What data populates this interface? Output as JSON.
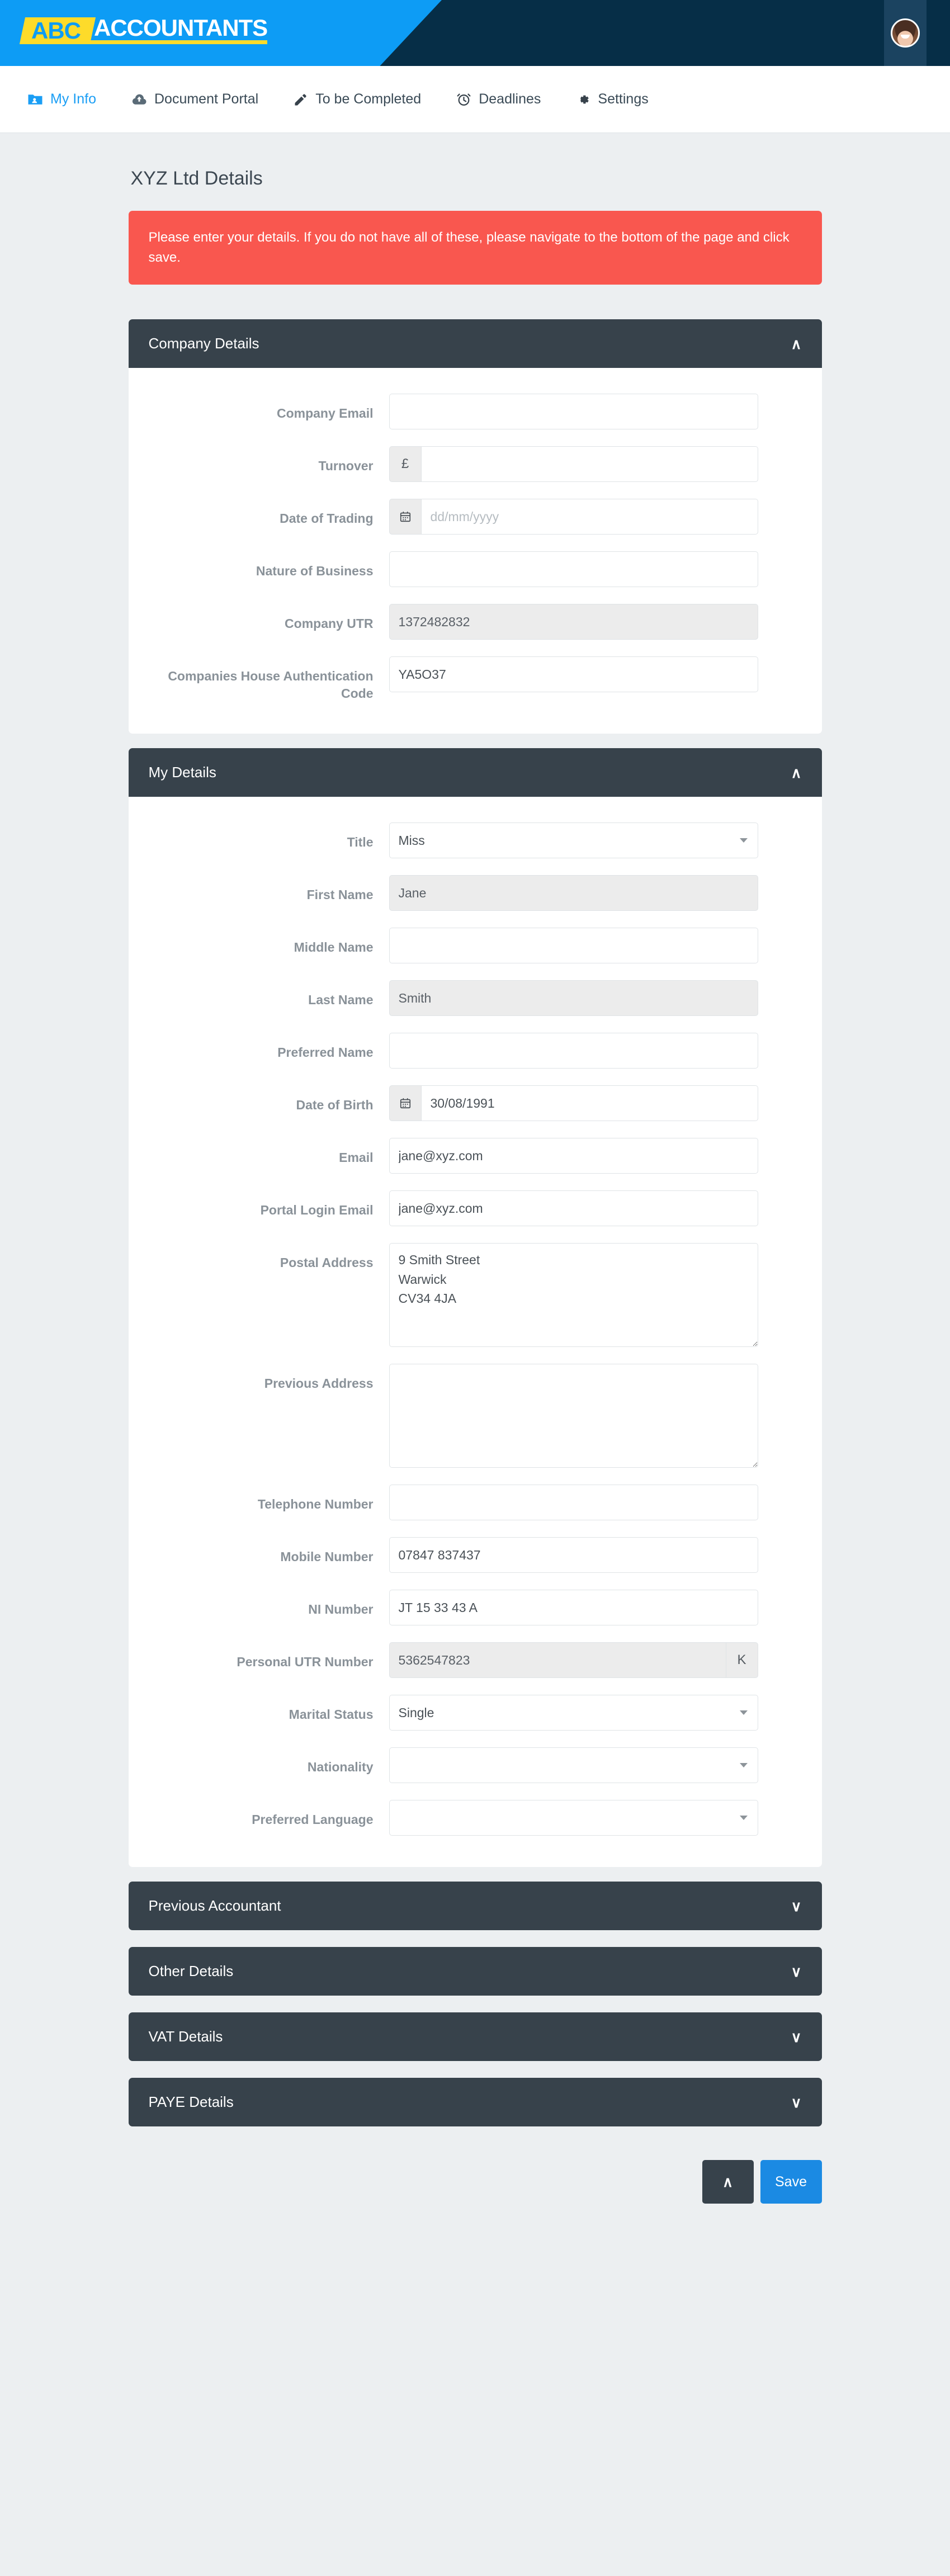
{
  "brand": {
    "logo_mark": "ABC",
    "logo_word": "ACCOUNTANTS",
    "blue": "#0d9cf5",
    "yellow": "#fddb2a",
    "navy": "#062e47"
  },
  "nav": {
    "items": [
      {
        "label": "My Info",
        "icon": "folder-user-icon",
        "active": true
      },
      {
        "label": "Document Portal",
        "icon": "cloud-upload-icon",
        "active": false
      },
      {
        "label": "To be Completed",
        "icon": "pencil-icon",
        "active": false
      },
      {
        "label": "Deadlines",
        "icon": "alarm-clock-icon",
        "active": false
      },
      {
        "label": "Settings",
        "icon": "gear-icon",
        "active": false
      }
    ]
  },
  "page": {
    "title": "XYZ Ltd Details",
    "alert": "Please enter your details. If you do not have all of these, please navigate to the bottom of the page and click save.",
    "alert_color": "#f9574f"
  },
  "panels": {
    "company": {
      "title": "Company Details",
      "chevron": "chevron-up-icon",
      "expanded": true,
      "fields": {
        "company_email": {
          "label": "Company Email",
          "value": ""
        },
        "turnover": {
          "label": "Turnover",
          "prefix": "£",
          "value": ""
        },
        "date_of_trading": {
          "label": "Date of Trading",
          "value": "",
          "placeholder": "dd/mm/yyyy"
        },
        "nature_of_business": {
          "label": "Nature of Business",
          "value": ""
        },
        "company_utr": {
          "label": "Company UTR",
          "value": "1372482832",
          "disabled": true
        },
        "companies_house_code": {
          "label": "Companies House Authentication Code",
          "value": "YA5O37"
        }
      }
    },
    "my_details": {
      "title": "My Details",
      "chevron": "chevron-up-icon",
      "expanded": true,
      "fields": {
        "title": {
          "label": "Title",
          "value": "Miss"
        },
        "first_name": {
          "label": "First Name",
          "value": "Jane",
          "disabled": true
        },
        "middle_name": {
          "label": "Middle Name",
          "value": ""
        },
        "last_name": {
          "label": "Last Name",
          "value": "Smith",
          "disabled": true
        },
        "preferred_name": {
          "label": "Preferred Name",
          "value": ""
        },
        "date_of_birth": {
          "label": "Date of Birth",
          "value": "30/08/1991"
        },
        "email": {
          "label": "Email",
          "value": "jane@xyz.com"
        },
        "portal_login_email": {
          "label": "Portal Login Email",
          "value": "jane@xyz.com"
        },
        "postal_address": {
          "label": "Postal Address",
          "value": "9 Smith Street\nWarwick\nCV34 4JA"
        },
        "previous_address": {
          "label": "Previous Address",
          "value": ""
        },
        "telephone_number": {
          "label": "Telephone Number",
          "value": ""
        },
        "mobile_number": {
          "label": "Mobile Number",
          "value": "07847 837437"
        },
        "ni_number": {
          "label": "NI Number",
          "value": "JT 15 33 43 A"
        },
        "personal_utr": {
          "label": "Personal UTR Number",
          "value": "5362547823",
          "suffix": "K",
          "disabled": true
        },
        "marital_status": {
          "label": "Marital Status",
          "value": "Single"
        },
        "nationality": {
          "label": "Nationality",
          "value": ""
        },
        "preferred_language": {
          "label": "Preferred Language",
          "value": ""
        }
      }
    },
    "collapsed": [
      {
        "title": "Previous Accountant",
        "chevron": "chevron-down-icon"
      },
      {
        "title": "Other Details",
        "chevron": "chevron-down-icon"
      },
      {
        "title": "VAT Details",
        "chevron": "chevron-down-icon"
      },
      {
        "title": "PAYE Details",
        "chevron": "chevron-down-icon"
      }
    ]
  },
  "footer": {
    "scroll_top_label": "∧",
    "save_label": "Save",
    "save_color": "#1b8ae3"
  }
}
